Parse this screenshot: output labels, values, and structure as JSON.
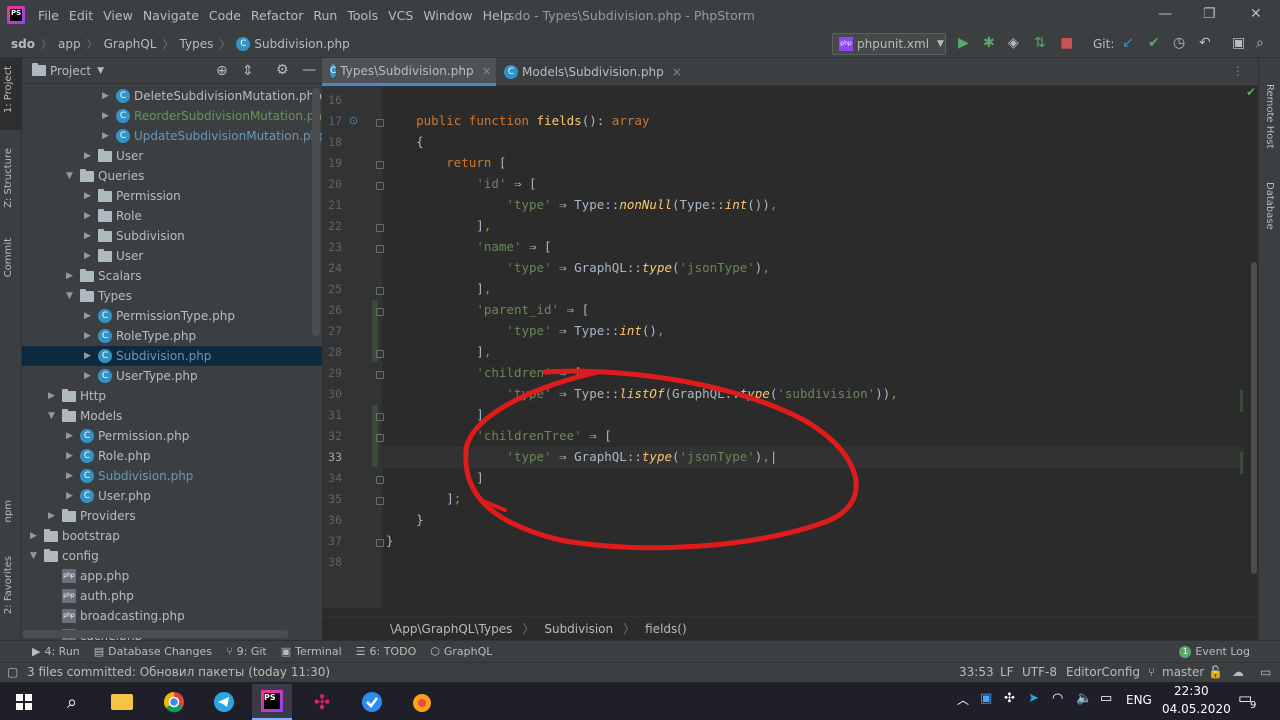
{
  "title_bar": {
    "menu": [
      "File",
      "Edit",
      "View",
      "Navigate",
      "Code",
      "Refactor",
      "Run",
      "Tools",
      "VCS",
      "Window",
      "Help"
    ],
    "window_title": "sdo - Types\\Subdivision.php - PhpStorm",
    "logo_text": "PS"
  },
  "nav_bar": {
    "crumbs": [
      "sdo",
      "app",
      "GraphQL",
      "Types",
      "Subdivision.php"
    ],
    "run_config": "phpunit.xml",
    "git_label": "Git:"
  },
  "left_strip": {
    "project": "1: Project",
    "structure": "Z: Structure",
    "commit": "Commit",
    "npm": "npm",
    "favorites": "2: Favorites"
  },
  "right_strip": {
    "remote": "Remote Host",
    "database": "Database"
  },
  "project_panel": {
    "title": "Project",
    "tree": [
      {
        "label": "DeleteSubdivisionMutation.php",
        "kind": "class",
        "indent": 5,
        "color": "#bbbbbb"
      },
      {
        "label": "ReorderSubdivisionMutation.php",
        "kind": "class",
        "indent": 5,
        "color": "#629755"
      },
      {
        "label": "UpdateSubdivisionMutation.php",
        "kind": "class",
        "indent": 5,
        "color": "#6897bb"
      },
      {
        "label": "User",
        "kind": "folder",
        "indent": 4,
        "color": "#bbbbbb",
        "arrow": "right"
      },
      {
        "label": "Queries",
        "kind": "folder",
        "indent": 3,
        "color": "#bbbbbb",
        "arrow": "down"
      },
      {
        "label": "Permission",
        "kind": "folder",
        "indent": 4,
        "color": "#bbbbbb",
        "arrow": "right"
      },
      {
        "label": "Role",
        "kind": "folder",
        "indent": 4,
        "color": "#bbbbbb",
        "arrow": "right"
      },
      {
        "label": "Subdivision",
        "kind": "folder",
        "indent": 4,
        "color": "#bbbbbb",
        "arrow": "right"
      },
      {
        "label": "User",
        "kind": "folder",
        "indent": 4,
        "color": "#bbbbbb",
        "arrow": "right"
      },
      {
        "label": "Scalars",
        "kind": "folder",
        "indent": 3,
        "color": "#bbbbbb",
        "arrow": "right"
      },
      {
        "label": "Types",
        "kind": "folder",
        "indent": 3,
        "color": "#bbbbbb",
        "arrow": "down"
      },
      {
        "label": "PermissionType.php",
        "kind": "class",
        "indent": 4,
        "color": "#bbbbbb"
      },
      {
        "label": "RoleType.php",
        "kind": "class",
        "indent": 4,
        "color": "#bbbbbb"
      },
      {
        "label": "Subdivision.php",
        "kind": "class",
        "indent": 4,
        "color": "#6897bb",
        "selected": true
      },
      {
        "label": "UserType.php",
        "kind": "class",
        "indent": 4,
        "color": "#bbbbbb"
      },
      {
        "label": "Http",
        "kind": "folder",
        "indent": 2,
        "color": "#bbbbbb",
        "arrow": "right"
      },
      {
        "label": "Models",
        "kind": "folder",
        "indent": 2,
        "color": "#bbbbbb",
        "arrow": "down"
      },
      {
        "label": "Permission.php",
        "kind": "class",
        "indent": 3,
        "color": "#bbbbbb"
      },
      {
        "label": "Role.php",
        "kind": "class",
        "indent": 3,
        "color": "#bbbbbb"
      },
      {
        "label": "Subdivision.php",
        "kind": "class",
        "indent": 3,
        "color": "#6897bb"
      },
      {
        "label": "User.php",
        "kind": "class",
        "indent": 3,
        "color": "#bbbbbb"
      },
      {
        "label": "Providers",
        "kind": "folder",
        "indent": 2,
        "color": "#bbbbbb",
        "arrow": "right"
      },
      {
        "label": "bootstrap",
        "kind": "folder",
        "indent": 1,
        "color": "#bbbbbb",
        "arrow": "right"
      },
      {
        "label": "config",
        "kind": "folder",
        "indent": 1,
        "color": "#bbbbbb",
        "arrow": "down"
      },
      {
        "label": "app.php",
        "kind": "php",
        "indent": 2,
        "color": "#bbbbbb"
      },
      {
        "label": "auth.php",
        "kind": "php",
        "indent": 2,
        "color": "#bbbbbb"
      },
      {
        "label": "broadcasting.php",
        "kind": "php",
        "indent": 2,
        "color": "#bbbbbb"
      },
      {
        "label": "cache.php",
        "kind": "php",
        "indent": 2,
        "color": "#bbbbbb"
      }
    ]
  },
  "tabs": [
    {
      "label": "Types\\Subdivision.php",
      "active": true
    },
    {
      "label": "Models\\Subdivision.php",
      "active": false
    }
  ],
  "editor": {
    "line_numbers": [
      "16",
      "17",
      "18",
      "19",
      "20",
      "21",
      "22",
      "23",
      "24",
      "25",
      "26",
      "27",
      "28",
      "29",
      "30",
      "31",
      "32",
      "33",
      "34",
      "35",
      "36",
      "37",
      "38"
    ],
    "lines": [
      [],
      [
        {
          "t": "    "
        },
        {
          "t": "public function ",
          "c": "kw"
        },
        {
          "t": "fields",
          "c": "fn"
        },
        {
          "t": "(): "
        },
        {
          "t": "array",
          "c": "kw"
        }
      ],
      [
        {
          "t": "    {"
        }
      ],
      [
        {
          "t": "        "
        },
        {
          "t": "return ",
          "c": "kw"
        },
        {
          "t": "["
        }
      ],
      [
        {
          "t": "            "
        },
        {
          "t": "'id'",
          "c": "str"
        },
        {
          "t": " ⇒ ["
        }
      ],
      [
        {
          "t": "                "
        },
        {
          "t": "'type'",
          "c": "str"
        },
        {
          "t": " ⇒ Type::"
        },
        {
          "t": "nonNull",
          "c": "it"
        },
        {
          "t": "(Type::"
        },
        {
          "t": "int",
          "c": "it"
        },
        {
          "t": "())"
        },
        {
          "t": ",",
          "c": "kw"
        }
      ],
      [
        {
          "t": "            ]"
        },
        {
          "t": ",",
          "c": "kw"
        }
      ],
      [
        {
          "t": "            "
        },
        {
          "t": "'name'",
          "c": "str"
        },
        {
          "t": " ⇒ ["
        }
      ],
      [
        {
          "t": "                "
        },
        {
          "t": "'type'",
          "c": "str"
        },
        {
          "t": " ⇒ GraphQL::"
        },
        {
          "t": "type",
          "c": "it"
        },
        {
          "t": "("
        },
        {
          "t": "'jsonType'",
          "c": "str"
        },
        {
          "t": ")"
        },
        {
          "t": ",",
          "c": "kw"
        }
      ],
      [
        {
          "t": "            ]"
        },
        {
          "t": ",",
          "c": "kw"
        }
      ],
      [
        {
          "t": "            "
        },
        {
          "t": "'parent_id'",
          "c": "str"
        },
        {
          "t": " ⇒ ["
        }
      ],
      [
        {
          "t": "                "
        },
        {
          "t": "'type'",
          "c": "str"
        },
        {
          "t": " ⇒ Type::"
        },
        {
          "t": "int",
          "c": "it"
        },
        {
          "t": "()"
        },
        {
          "t": ",",
          "c": "kw"
        }
      ],
      [
        {
          "t": "            ]"
        },
        {
          "t": ",",
          "c": "kw"
        }
      ],
      [
        {
          "t": "            "
        },
        {
          "t": "'children'",
          "c": "str"
        },
        {
          "t": " ⇒ ["
        }
      ],
      [
        {
          "t": "                "
        },
        {
          "t": "'type'",
          "c": "str"
        },
        {
          "t": " ⇒ Type::"
        },
        {
          "t": "listOf",
          "c": "it"
        },
        {
          "t": "(GraphQL::"
        },
        {
          "t": "type",
          "c": "it"
        },
        {
          "t": "("
        },
        {
          "t": "'subdivision'",
          "c": "str"
        },
        {
          "t": "))"
        },
        {
          "t": ",",
          "c": "kw"
        }
      ],
      [
        {
          "t": "            ]"
        },
        {
          "t": ",",
          "c": "kw"
        }
      ],
      [
        {
          "t": "            "
        },
        {
          "t": "'childrenTree'",
          "c": "str"
        },
        {
          "t": " ⇒ ["
        }
      ],
      [
        {
          "t": "                "
        },
        {
          "t": "'type'",
          "c": "str"
        },
        {
          "t": " ⇒ GraphQL::"
        },
        {
          "t": "type",
          "c": "it"
        },
        {
          "t": "("
        },
        {
          "t": "'jsonType'",
          "c": "str"
        },
        {
          "t": ")"
        },
        {
          "t": ",",
          "c": "kw"
        },
        {
          "t": "|"
        }
      ],
      [
        {
          "t": "            ]"
        }
      ],
      [
        {
          "t": "        ]"
        },
        {
          "t": ";",
          "c": "kw"
        }
      ],
      [
        {
          "t": "    }"
        }
      ],
      [
        {
          "t": "}"
        }
      ],
      []
    ]
  },
  "editor_breadcrumb": [
    "\\App\\GraphQL\\Types",
    "Subdivision",
    "fields()"
  ],
  "bottom_tools": {
    "run": "4: Run",
    "db_changes": "Database Changes",
    "git": "9: Git",
    "terminal": "Terminal",
    "todo": "6: TODO",
    "graphql": "GraphQL",
    "event_log": "Event Log"
  },
  "status_bar": {
    "message": "3 files committed: Обновил пакеты (today 11:30)",
    "position": "33:53",
    "line_sep": "LF",
    "encoding": "UTF-8",
    "editor_config": "EditorConfig",
    "branch": "master"
  },
  "taskbar": {
    "lang": "ENG",
    "time": "22:30",
    "date": "04.05.2020",
    "notif_count": "9"
  },
  "colors": {
    "annotation": "#e01b1b",
    "accent": "#4a88c7"
  }
}
